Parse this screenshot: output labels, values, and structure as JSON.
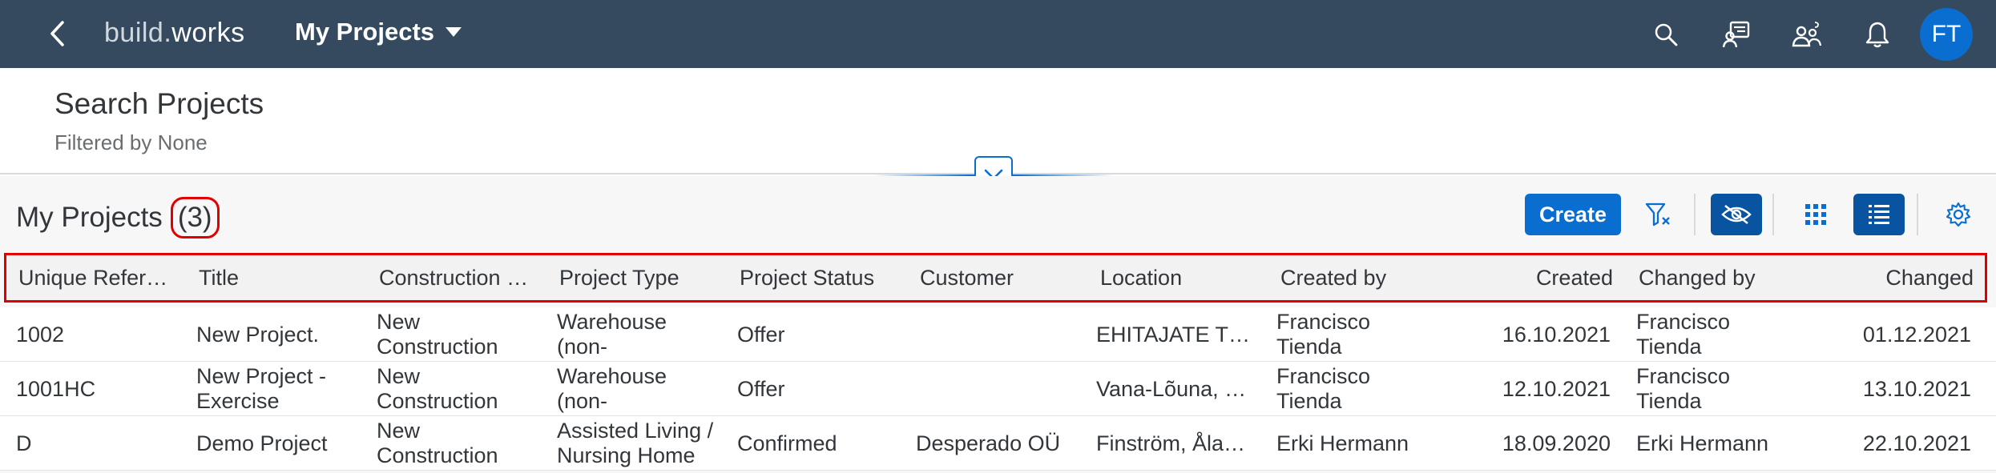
{
  "shell": {
    "brand_a": "build",
    "brand_dot": ".",
    "brand_b": "works",
    "app_title": "My Projects",
    "avatar_initials": "FT",
    "colors": {
      "shellbar": "#354a5f",
      "accent": "#0a6ed1",
      "highlight": "#e00000"
    }
  },
  "header": {
    "title": "Search Projects",
    "subtitle": "Filtered by None"
  },
  "table": {
    "title": "My Projects",
    "count": "(3)",
    "create_label": "Create",
    "columns": [
      "Unique Refer…",
      "Title",
      "Construction …",
      "Project Type",
      "Project Status",
      "Customer",
      "Location",
      "Created by",
      "Created",
      "Changed by",
      "Changed"
    ],
    "rows": [
      {
        "ref": "1002",
        "title": "New Project.",
        "construction": "New Construction",
        "type": "Warehouse (non-",
        "status": "Offer",
        "customer": "",
        "location": "EHITAJATE T…",
        "created_by": "Francisco Tienda",
        "created": "16.10.2021",
        "changed_by": "Francisco Tienda",
        "changed": "01.12.2021"
      },
      {
        "ref": "1001HC",
        "title": "New Project - Exercise",
        "construction": "New Construction",
        "type": "Warehouse (non-",
        "status": "Offer",
        "customer": "",
        "location": "Vana-Lõuna, …",
        "created_by": "Francisco Tienda",
        "created": "12.10.2021",
        "changed_by": "Francisco Tienda",
        "changed": "13.10.2021"
      },
      {
        "ref": "D",
        "title": "Demo Project",
        "construction": "New Construction",
        "type": "Assisted Living / Nursing Home",
        "status": "Confirmed",
        "customer": "Desperado OÜ",
        "location": "Finström, Åla…",
        "created_by": "Erki Hermann",
        "created": "18.09.2020",
        "changed_by": "Erki Hermann",
        "changed": "22.10.2021"
      }
    ]
  }
}
